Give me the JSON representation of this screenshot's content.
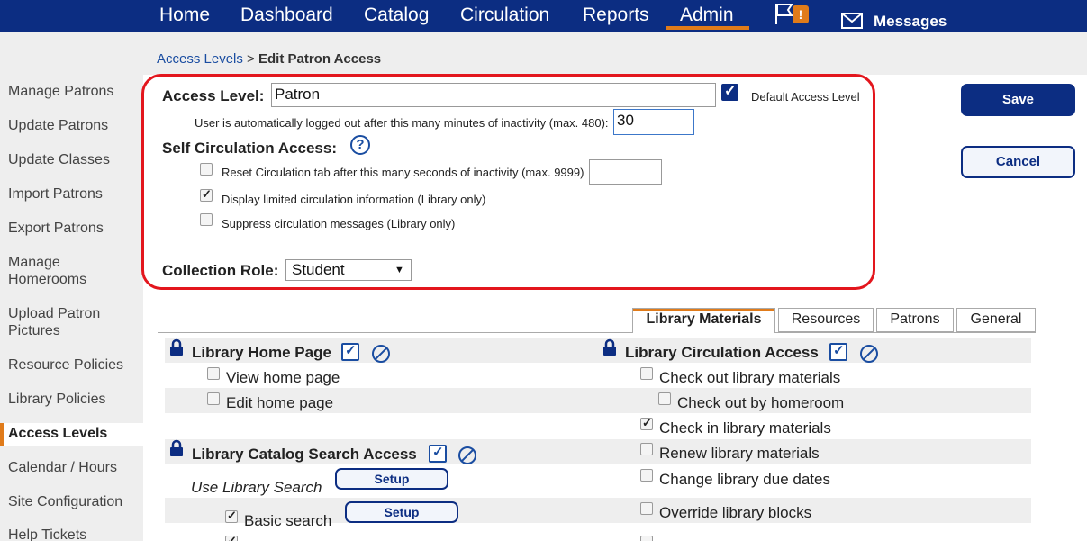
{
  "nav": {
    "items": [
      "Home",
      "Dashboard",
      "Catalog",
      "Circulation",
      "Reports",
      "Admin"
    ],
    "flag_badge": "!",
    "messages": "Messages"
  },
  "breadcrumb": {
    "link": "Access Levels",
    "separator": ">",
    "current": "Edit Patron Access"
  },
  "sidebar": {
    "items": [
      "Manage Patrons",
      "Update Patrons",
      "Update Classes",
      "Import Patrons",
      "Export Patrons",
      "Manage Homerooms",
      "Upload Patron Pictures",
      "Resource Policies",
      "Library Policies",
      "Access Levels",
      "Calendar / Hours",
      "Site Configuration",
      "Help Tickets"
    ],
    "active": "Access Levels"
  },
  "form": {
    "access_level_label": "Access Level:",
    "access_level_value": "Patron",
    "default_access_label": "Default Access Level",
    "logout_label": "User is automatically logged out after this many minutes of inactivity (max. 480):",
    "logout_value": "30",
    "self_circ_label": "Self Circulation Access:",
    "help_glyph": "?",
    "reset_label": "Reset Circulation tab after this many seconds of inactivity (max. 9999)",
    "reset_value": "",
    "display_limited_label": "Display limited circulation information (Library only)",
    "suppress_label": "Suppress circulation messages (Library only)",
    "collection_role_label": "Collection Role:",
    "collection_role_value": "Student"
  },
  "buttons": {
    "save": "Save",
    "cancel": "Cancel",
    "setup": "Setup"
  },
  "tabs": [
    "Library Materials",
    "Resources",
    "Patrons",
    "General"
  ],
  "permissions": {
    "home_page": {
      "title": "Library Home Page",
      "items": [
        "View home page",
        "Edit home page"
      ]
    },
    "catalog_search": {
      "title": "Library Catalog Search Access",
      "use_search": "Use Library Search",
      "basic": "Basic search"
    },
    "circulation": {
      "title": "Library Circulation Access",
      "items": [
        "Check out library materials",
        "Check out by homeroom",
        "Check in library materials",
        "Renew library materials",
        "Change library due dates",
        "Override library blocks"
      ]
    }
  },
  "colors": {
    "brand": "#0c2d82",
    "accent": "#e07b1a",
    "highlight": "#e3161d"
  }
}
